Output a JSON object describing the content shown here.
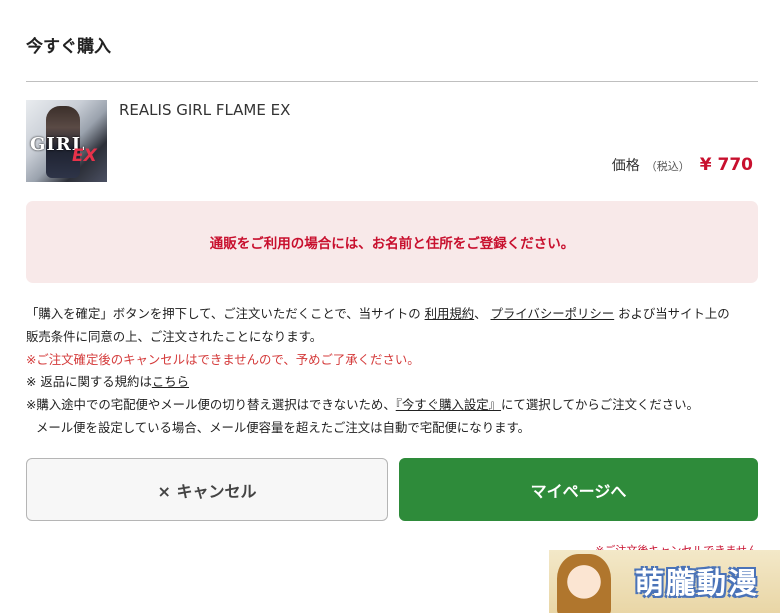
{
  "dialog": {
    "title": "今すぐ購入"
  },
  "product": {
    "name": "REALIS GIRL FLAME EX",
    "thumbnail_logo": "GIRL",
    "thumbnail_logo_suffix": "EX",
    "price_label": "価格",
    "price_tax": "（税込）",
    "price_value": "¥ 770"
  },
  "notice": {
    "text": "通販をご利用の場合には、お名前と住所をご登録ください。"
  },
  "terms": {
    "line1_prefix": "「購入を確定」ボタンを押下して、ご注文いただくことで、当サイトの ",
    "terms_link": "利用規約",
    "separator": "、 ",
    "privacy_link": "プライバシーポリシー",
    "line1_suffix": " および当サイト上の",
    "line2": "販売条件に同意の上、ご注文されたことになります。",
    "line3_warning": "※ご注文確定後のキャンセルはできませんので、予めご了承ください。",
    "line4_prefix": "※ 返品に関する規約は",
    "returns_link": "こちら",
    "line5_prefix": "※購入途中での宅配便やメール便の切り替え選択はできないため、",
    "settings_link": "『今すぐ購入設定』",
    "line5_suffix": "にて選択してからご注文ください。",
    "line6": "メール便を設定している場合、メール便容量を超えたご注文は自動で宅配便になります。"
  },
  "buttons": {
    "cancel_label": "× キャンセル",
    "mypage_label": "マイページへ"
  },
  "footer": {
    "cancel_note": "※ご注文後キャンセルできません"
  },
  "watermark": {
    "text": "萌朧動漫"
  },
  "colors": {
    "accent_red": "#c8102e",
    "primary_green": "#2e8b3a",
    "notice_bg": "#f8e9e9"
  }
}
